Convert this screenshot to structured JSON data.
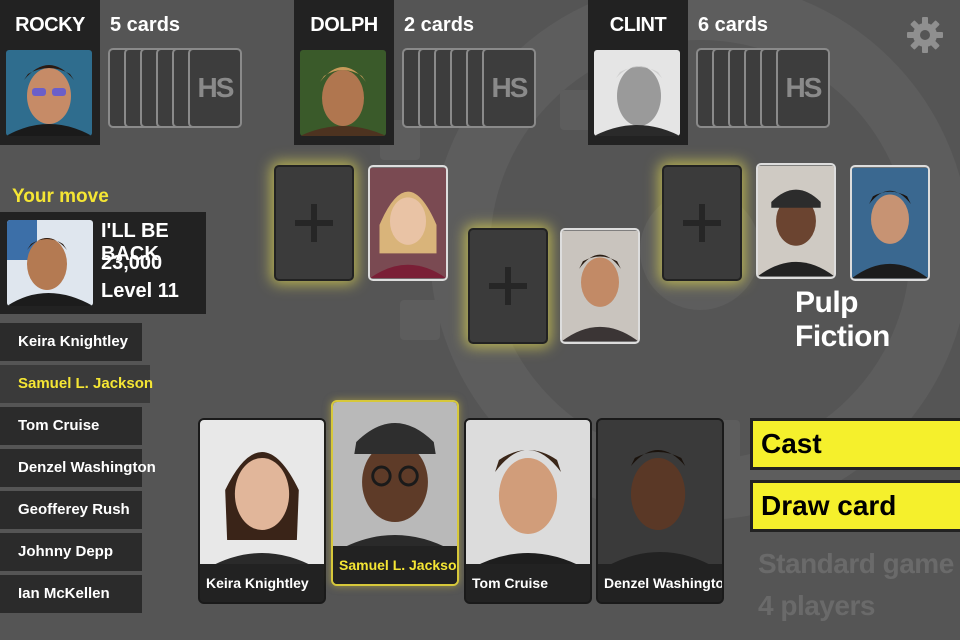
{
  "opponents": [
    {
      "name": "ROCKY",
      "card_count": "5 cards",
      "cards": 5
    },
    {
      "name": "DOLPH",
      "card_count": "2 cards",
      "cards": 6
    },
    {
      "name": "CLINT",
      "card_count": "6 cards",
      "cards": 6
    }
  ],
  "card_back_logo": "HS",
  "player": {
    "status": "Your move",
    "name": "I'LL BE BACK",
    "score": "23,000",
    "level": "Level 11"
  },
  "hand_list": [
    "Keira Knightley",
    "Samuel L. Jackson",
    "Tom Cruise",
    "Denzel Washington",
    "Geofferey Rush",
    "Johnny Depp",
    "Ian McKellen"
  ],
  "selected_actor": "Samuel L. Jackson",
  "board": {
    "movie_title": "Pulp Fiction"
  },
  "hand_cards": [
    {
      "name": "Keira Knightley"
    },
    {
      "name": "Samuel L. Jackson"
    },
    {
      "name": "Tom Cruise"
    },
    {
      "name": "Denzel Washington"
    }
  ],
  "actions": {
    "cast": "Cast",
    "draw": "Draw card"
  },
  "game_info": {
    "mode": "Standard game",
    "players": "4 players"
  },
  "colors": {
    "accent": "#f5f02c",
    "highlight_text": "#f5e634",
    "background": "#555555",
    "panel": "#222222"
  },
  "icons": {
    "settings": "gear-icon",
    "add_slot": "plus-icon"
  }
}
